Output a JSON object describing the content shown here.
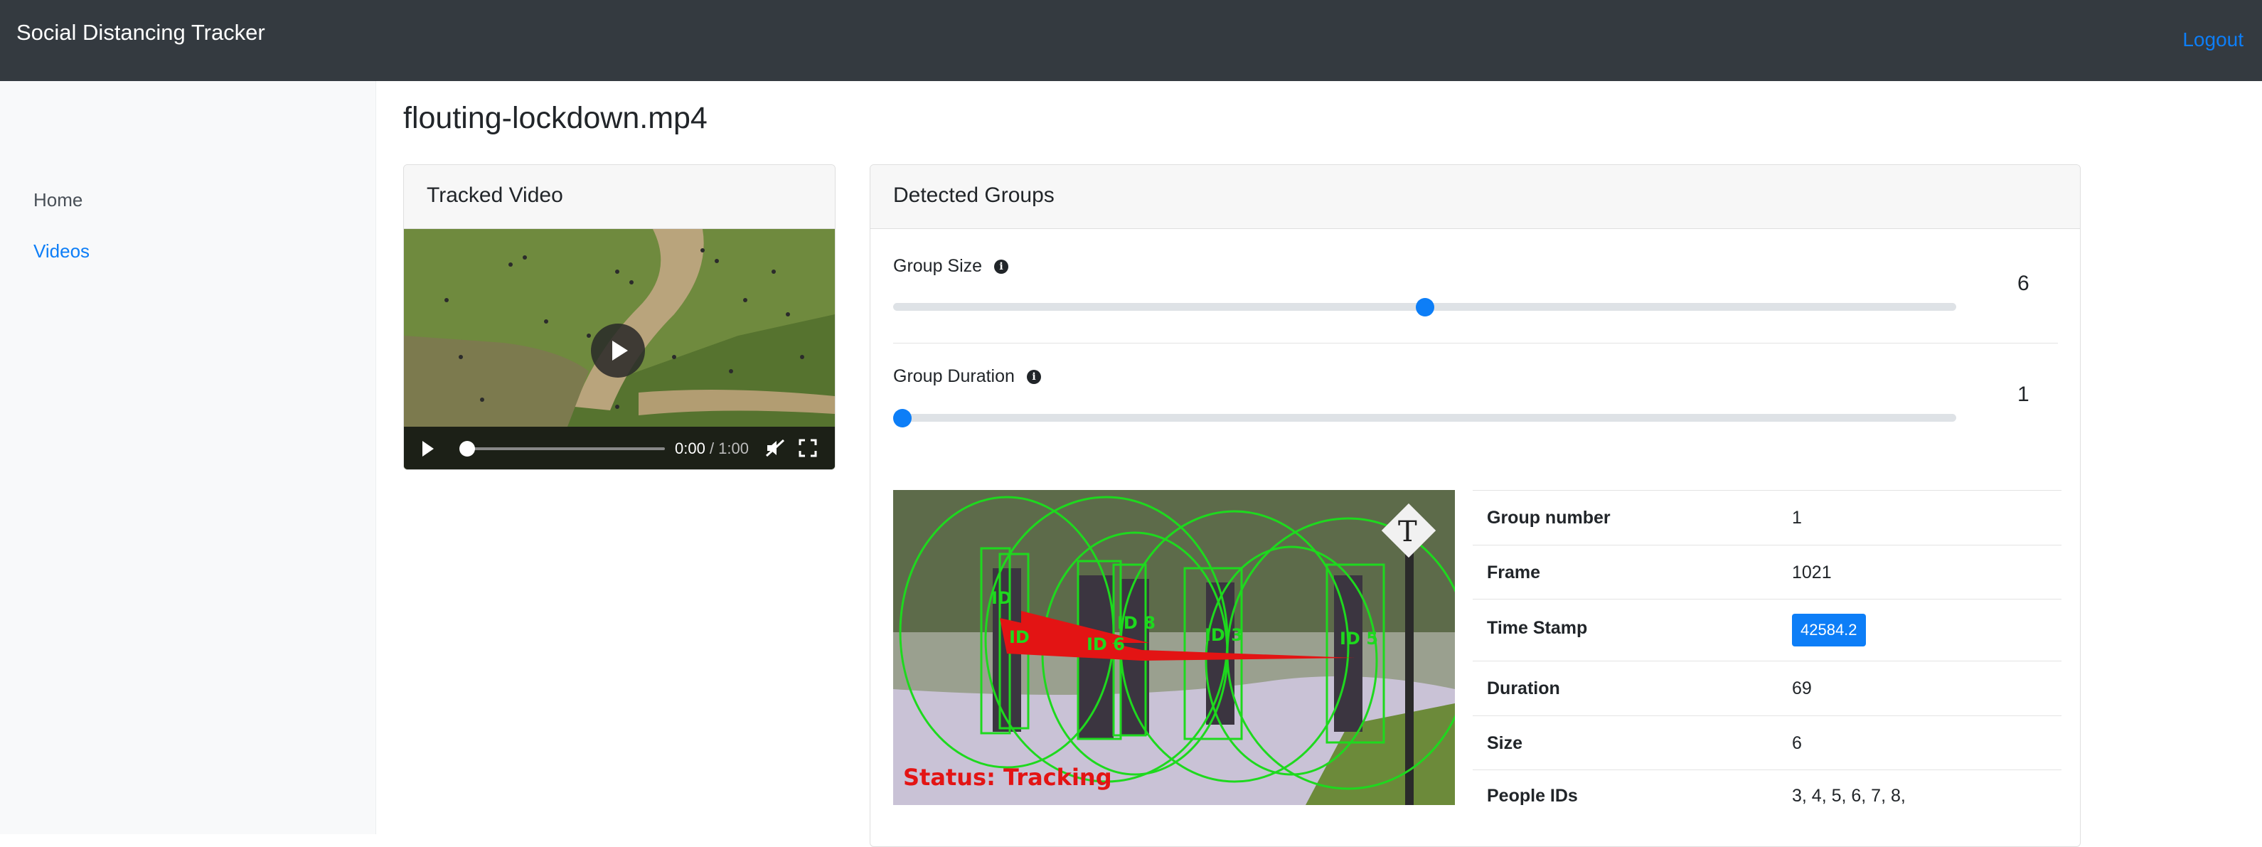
{
  "navbar": {
    "brand": "Social Distancing Tracker",
    "logout": "Logout"
  },
  "sidebar": {
    "items": [
      {
        "label": "Home"
      },
      {
        "label": "Videos"
      }
    ]
  },
  "page": {
    "title": "flouting-lockdown.mp4"
  },
  "tracked_video": {
    "title": "Tracked Video",
    "current_time": "0:00",
    "duration": "/ 1:00",
    "progress": 0
  },
  "detected_groups": {
    "title": "Detected Groups",
    "group_size": {
      "label": "Group Size",
      "value": "6",
      "fraction": 0.5
    },
    "group_duration": {
      "label": "Group Duration",
      "value": "1",
      "fraction": 0.0
    },
    "frame_overlay": {
      "status": "Status: Tracking",
      "id_labels": [
        "ID",
        "ID",
        "ID 6",
        "ID 8",
        "ID 3",
        "ID 5"
      ],
      "logo": "T"
    },
    "details": [
      {
        "key": "Group number",
        "value": "1"
      },
      {
        "key": "Frame",
        "value": "1021"
      },
      {
        "key": "Time Stamp",
        "value": "42584.2"
      },
      {
        "key": "Duration",
        "value": "69"
      },
      {
        "key": "Size",
        "value": "6"
      },
      {
        "key": "People IDs",
        "value": "3, 4, 5, 6, 7, 8,"
      }
    ]
  },
  "colors": {
    "navbar": "#343a40",
    "accent": "#0d7ef7",
    "tracking_green": "#1ed91e",
    "status_red": "#e31414"
  }
}
